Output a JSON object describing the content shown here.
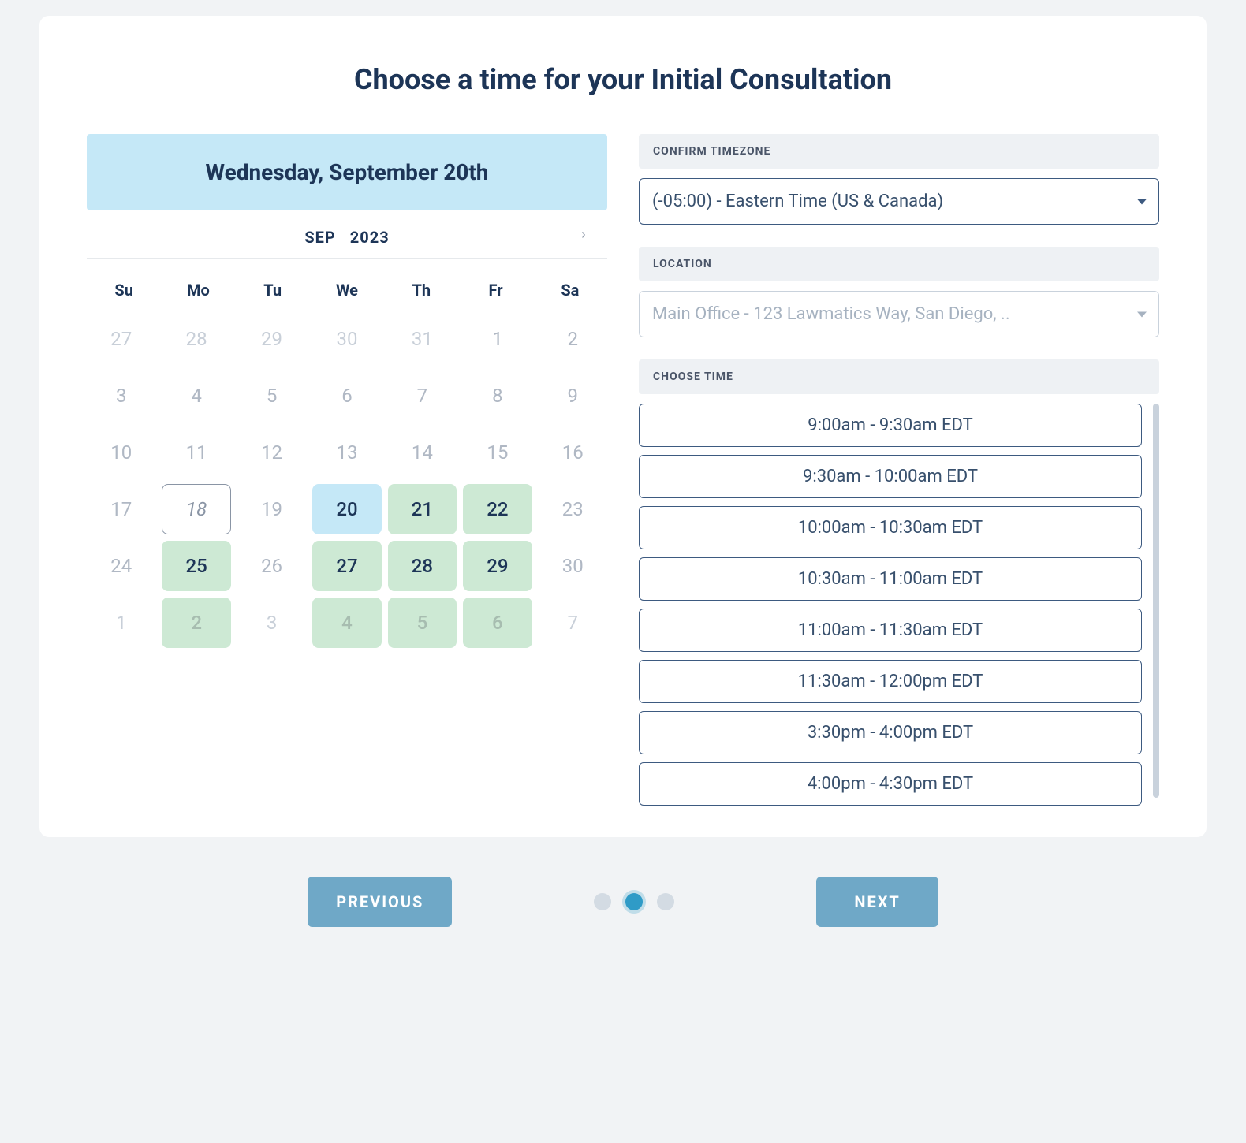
{
  "title": "Choose a time for your Initial Consultation",
  "selected_date_label": "Wednesday, September 20th",
  "calendar": {
    "month_label": "SEP",
    "year_label": "2023",
    "weekdays": [
      "Su",
      "Mo",
      "Tu",
      "We",
      "Th",
      "Fr",
      "Sa"
    ],
    "days": [
      {
        "n": "27",
        "cls": "out"
      },
      {
        "n": "28",
        "cls": "out"
      },
      {
        "n": "29",
        "cls": "out"
      },
      {
        "n": "30",
        "cls": "out"
      },
      {
        "n": "31",
        "cls": "out"
      },
      {
        "n": "1",
        "cls": ""
      },
      {
        "n": "2",
        "cls": ""
      },
      {
        "n": "3",
        "cls": ""
      },
      {
        "n": "4",
        "cls": ""
      },
      {
        "n": "5",
        "cls": ""
      },
      {
        "n": "6",
        "cls": ""
      },
      {
        "n": "7",
        "cls": ""
      },
      {
        "n": "8",
        "cls": ""
      },
      {
        "n": "9",
        "cls": ""
      },
      {
        "n": "10",
        "cls": ""
      },
      {
        "n": "11",
        "cls": ""
      },
      {
        "n": "12",
        "cls": ""
      },
      {
        "n": "13",
        "cls": ""
      },
      {
        "n": "14",
        "cls": ""
      },
      {
        "n": "15",
        "cls": ""
      },
      {
        "n": "16",
        "cls": ""
      },
      {
        "n": "17",
        "cls": ""
      },
      {
        "n": "18",
        "cls": "today"
      },
      {
        "n": "19",
        "cls": ""
      },
      {
        "n": "20",
        "cls": "selected"
      },
      {
        "n": "21",
        "cls": "available"
      },
      {
        "n": "22",
        "cls": "available"
      },
      {
        "n": "23",
        "cls": ""
      },
      {
        "n": "24",
        "cls": ""
      },
      {
        "n": "25",
        "cls": "available"
      },
      {
        "n": "26",
        "cls": ""
      },
      {
        "n": "27",
        "cls": "available"
      },
      {
        "n": "28",
        "cls": "available"
      },
      {
        "n": "29",
        "cls": "available"
      },
      {
        "n": "30",
        "cls": ""
      },
      {
        "n": "1",
        "cls": "out"
      },
      {
        "n": "2",
        "cls": "available-muted"
      },
      {
        "n": "3",
        "cls": "out"
      },
      {
        "n": "4",
        "cls": "available-muted"
      },
      {
        "n": "5",
        "cls": "available-muted"
      },
      {
        "n": "6",
        "cls": "available-muted"
      },
      {
        "n": "7",
        "cls": "out"
      }
    ]
  },
  "timezone": {
    "label": "CONFIRM TIMEZONE",
    "value": "(-05:00) - Eastern Time (US & Canada)"
  },
  "location": {
    "label": "LOCATION",
    "value": "Main Office - 123 Lawmatics Way, San Diego, .."
  },
  "timeslots": {
    "label": "CHOOSE TIME",
    "options": [
      "9:00am - 9:30am EDT",
      "9:30am - 10:00am EDT",
      "10:00am - 10:30am EDT",
      "10:30am - 11:00am EDT",
      "11:00am - 11:30am EDT",
      "11:30am - 12:00pm EDT",
      "3:30pm - 4:00pm EDT",
      "4:00pm - 4:30pm EDT"
    ]
  },
  "nav": {
    "previous_label": "PREVIOUS",
    "next_label": "NEXT"
  }
}
